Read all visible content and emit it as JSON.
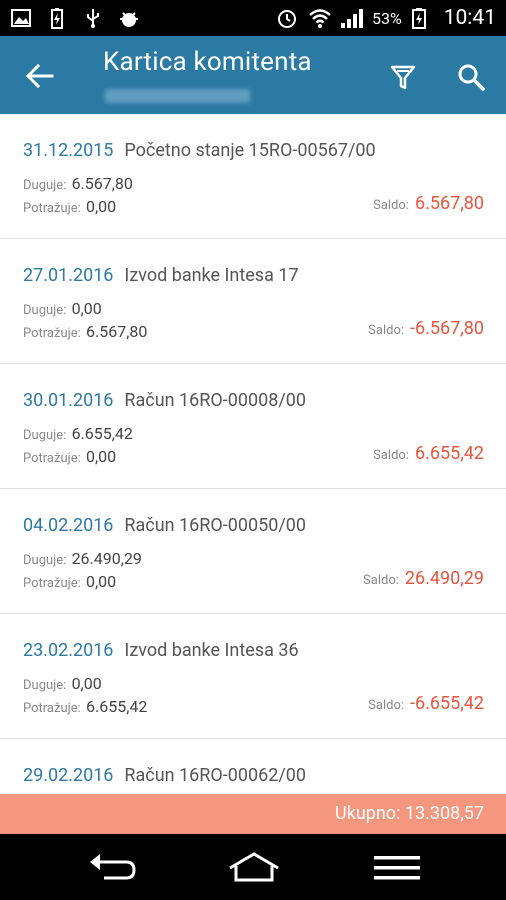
{
  "status_bar": {
    "battery_percent": "53%",
    "time": "10:41",
    "icons": [
      "image-icon",
      "battery-charge-icon",
      "usb-icon",
      "android-debug-icon",
      "alarm-icon",
      "wifi-icon",
      "signal-icon",
      "battery-icon"
    ]
  },
  "app_bar": {
    "title": "Kartica komitenta",
    "subtitle_redacted": true,
    "icons": [
      "back-arrow-icon",
      "filter-icon",
      "search-icon"
    ]
  },
  "labels": {
    "debit": "Duguje:",
    "credit": "Potražuje:",
    "balance": "Saldo:"
  },
  "entries": [
    {
      "date": "31.12.2015",
      "description": "Početno stanje 15RO-00567/00",
      "debit": "6.567,80",
      "credit": "0,00",
      "balance": "6.567,80"
    },
    {
      "date": "27.01.2016",
      "description": "Izvod banke Intesa 17",
      "debit": "0,00",
      "credit": "6.567,80",
      "balance": "-6.567,80"
    },
    {
      "date": "30.01.2016",
      "description": "Račun 16RO-00008/00",
      "debit": "6.655,42",
      "credit": "0,00",
      "balance": "6.655,42"
    },
    {
      "date": "04.02.2016",
      "description": "Račun 16RO-00050/00",
      "debit": "26.490,29",
      "credit": "0,00",
      "balance": "26.490,29"
    },
    {
      "date": "23.02.2016",
      "description": "Izvod banke Intesa 36",
      "debit": "0,00",
      "credit": "6.655,42",
      "balance": "-6.655,42"
    },
    {
      "date": "29.02.2016",
      "description": "Račun 16RO-00062/00",
      "debit": "",
      "credit": "",
      "balance": ""
    }
  ],
  "total": {
    "text": "Ukupno: 13.308,57"
  },
  "colors": {
    "app_bar": "#2b7aa4",
    "date": "#2e7aa3",
    "balance": "#e8553f",
    "total_bar": "#f5967f"
  },
  "nav_bar": {
    "icons": [
      "back-nav-icon",
      "home-nav-icon",
      "menu-nav-icon"
    ]
  }
}
